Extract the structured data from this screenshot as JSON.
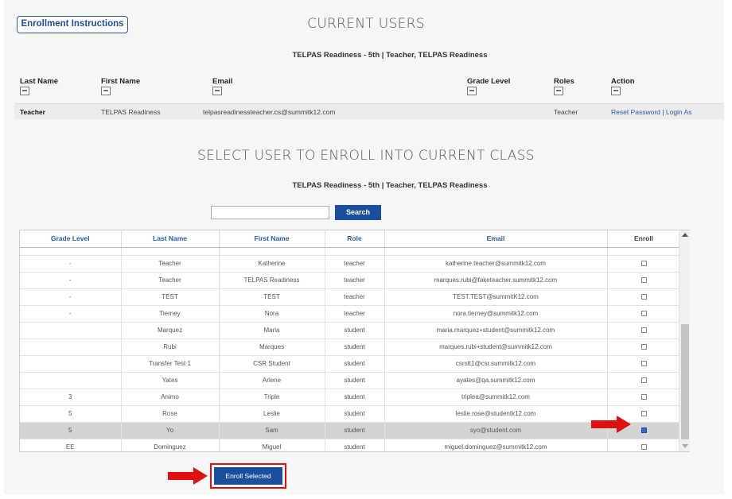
{
  "enroll_instructions_label": "Enrollment Instructions",
  "current_users": {
    "title": "CURRENT USERS",
    "subtitle": "TELPAS Readiness - 5th | Teacher, TELPAS Readiness",
    "columns": [
      "Last Name",
      "First Name",
      "Email",
      "Grade Level",
      "Roles",
      "Action"
    ],
    "row": {
      "last_name": "Teacher",
      "first_name": "TELPAS Readiness",
      "email": "telpasreadinessteacher.cs@summitk12.com",
      "roles": "Teacher",
      "reset_password": "Reset Password",
      "separator": "|",
      "login_as": "Login As"
    }
  },
  "enroll": {
    "title": "SELECT USER TO ENROLL INTO CURRENT CLASS",
    "subtitle": "TELPAS Readiness - 5th | Teacher, TELPAS Readiness",
    "search_value": "",
    "search_label": "Search",
    "columns": [
      "Grade Level",
      "Last Name",
      "First Name",
      "Role",
      "Email",
      "Enroll"
    ],
    "rows": [
      {
        "grade": "-",
        "last": "Teacher",
        "first": "Katherine",
        "role": "teacher",
        "email": "katherine.teacher@summitk12.com",
        "checked": false
      },
      {
        "grade": "-",
        "last": "Teacher",
        "first": "TELPAS Readiness",
        "role": "teacher",
        "email": "marques.rubi@faketeacher.summitk12.com",
        "checked": false
      },
      {
        "grade": "-",
        "last": "TEST",
        "first": "TEST",
        "role": "teacher",
        "email": "TEST.TEST@summitK12.com",
        "checked": false
      },
      {
        "grade": "-",
        "last": "Tierney",
        "first": "Nora",
        "role": "teacher",
        "email": "nora.tierney@summitk12.com",
        "checked": false
      },
      {
        "grade": "",
        "last": "Marquez",
        "first": "Maria",
        "role": "student",
        "email": "maria.marquez+student@summitk12.com",
        "checked": false
      },
      {
        "grade": "",
        "last": "Rubi",
        "first": "Marques",
        "role": "student",
        "email": "marques.rubi+student@summitk12.com",
        "checked": false
      },
      {
        "grade": "",
        "last": "Transfer Test 1",
        "first": "CSR Student",
        "role": "student",
        "email": "csrstt1@csr.summitk12.com",
        "checked": false
      },
      {
        "grade": "",
        "last": "Yates",
        "first": "Arlene",
        "role": "student",
        "email": "ayates@qa.summitk12.com",
        "checked": false
      },
      {
        "grade": "3",
        "last": "Animo",
        "first": "Triple",
        "role": "student",
        "email": "triplea@summitk12.com",
        "checked": false
      },
      {
        "grade": "5",
        "last": "Rose",
        "first": "Leslie",
        "role": "student",
        "email": "leslie.rose@studentk12.com",
        "checked": false
      },
      {
        "grade": "5",
        "last": "Yo",
        "first": "Sam",
        "role": "student",
        "email": "syo@student.com",
        "checked": true
      },
      {
        "grade": "EE",
        "last": "Dominguez",
        "first": "Miguel",
        "role": "student",
        "email": "miguel.dominguez@summitk12.com",
        "checked": false
      }
    ],
    "enroll_selected_label": "Enroll Selected"
  },
  "colors": {
    "accent": "#1a4fa0",
    "annotation": "#e01010",
    "selected_row": "#d4d4d4"
  }
}
